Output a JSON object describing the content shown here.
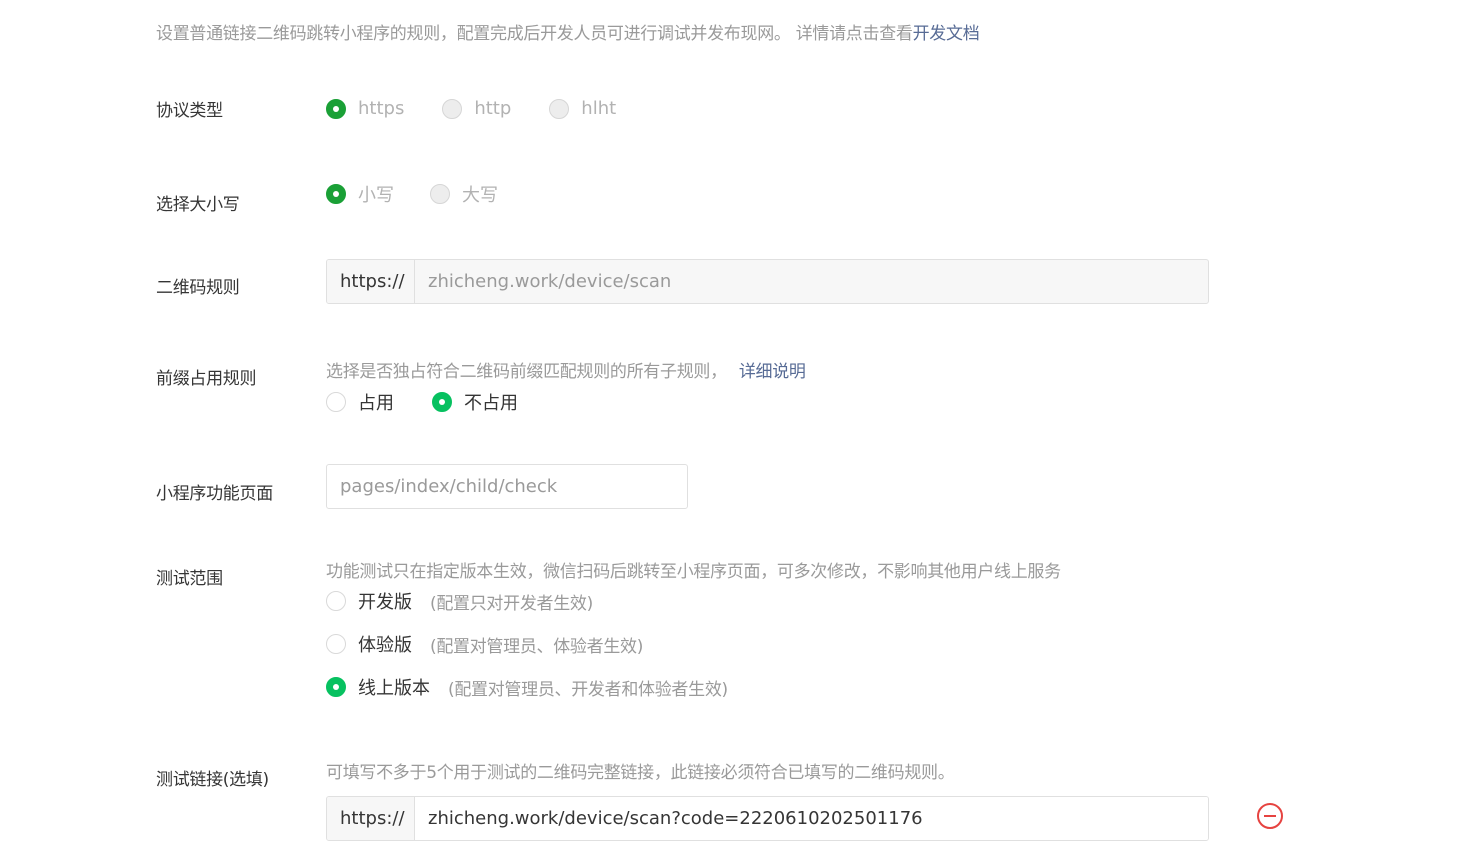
{
  "intro": {
    "text": "设置普通链接二维码跳转小程序的规则，配置完成后开发人员可进行调试并发布现网。 详情请点击查看",
    "link": "开发文档"
  },
  "protocol": {
    "label": "协议类型",
    "options": [
      "https",
      "http",
      "hlht"
    ],
    "selected": "https"
  },
  "case": {
    "label": "选择大小写",
    "options": [
      "小写",
      "大写"
    ],
    "selected": "小写"
  },
  "qr_rule": {
    "label": "二维码规则",
    "prefix": "https://",
    "value": "zhicheng.work/device/scan"
  },
  "prefix_rule": {
    "label": "前缀占用规则",
    "hint": "选择是否独占符合二维码前缀匹配规则的所有子规则，",
    "hint_link": "详细说明",
    "options": [
      "占用",
      "不占用"
    ],
    "selected": "不占用"
  },
  "page": {
    "label": "小程序功能页面",
    "value": "pages/index/child/check"
  },
  "test_scope": {
    "label": "测试范围",
    "hint": "功能测试只在指定版本生效，微信扫码后跳转至小程序页面，可多次修改，不影响其他用户线上服务",
    "options": [
      {
        "label": "开发版",
        "note": "(配置只对开发者生效)"
      },
      {
        "label": "体验版",
        "note": "(配置对管理员、体验者生效)"
      },
      {
        "label": "线上版本",
        "note": "(配置对管理员、开发者和体验者生效)"
      }
    ],
    "selected": "线上版本"
  },
  "test_link": {
    "label": "测试链接(选填)",
    "hint": "可填写不多于5个用于测试的二维码完整链接，此链接必须符合已填写的二维码规则。",
    "prefix": "https://",
    "value": "zhicheng.work/device/scan?code=2220610202501176",
    "remove_icon": "minus-circle-icon"
  },
  "colors": {
    "accent_green": "#07c160",
    "link_blue": "#576b95",
    "danger_red": "#e64340"
  }
}
